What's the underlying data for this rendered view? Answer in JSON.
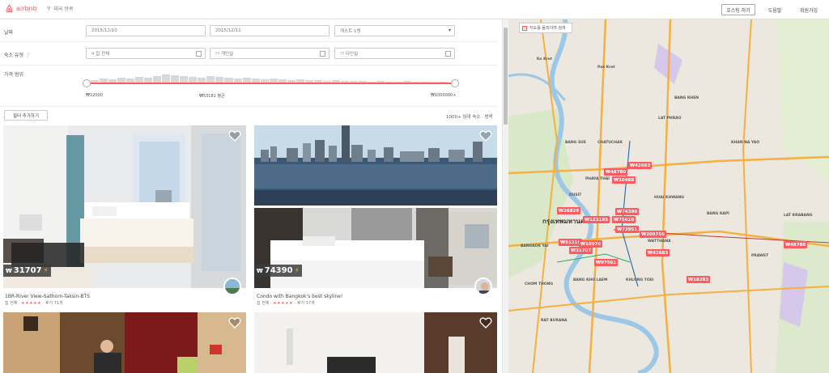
{
  "header": {
    "logo_text": "airbnb",
    "search_text": "태국 방콕",
    "host_label": "호스팅 하기",
    "help_label": "도움말",
    "signup_label": "회원가입"
  },
  "filters": {
    "dates_label": "날짜",
    "checkin": "2015/12/10",
    "checkout": "2015/12/11",
    "guests": "게스트 1명",
    "room_type_label": "숙소 유형",
    "room_types": [
      "집 전체",
      "개인실",
      "다인실"
    ],
    "price_label": "가격 범위",
    "price_min": "₩12000",
    "price_avg": "₩53181 평균",
    "price_max": "₩1000000+",
    "more_filters": "필터 추가하기",
    "result_count": "1000+ 임대 숙소 · 방콕"
  },
  "listings": [
    {
      "price": "31707",
      "title": "1BR-River View-Sathorn-Taksin-BTS",
      "type": "집 전체",
      "stars": "★★★★★",
      "reviews": "· 후기 71개"
    },
    {
      "price": "74390",
      "title": "Condo with Bangkok's best skyline!",
      "type": "집 전체",
      "stars": "★★★★★",
      "reviews": "· 후기 37개"
    }
  ],
  "map": {
    "search_checkbox_label": "지도를 움직이며 검색",
    "pins": [
      "₩48780",
      "₩42683",
      "₩10488",
      "₩74390",
      "₩26829",
      "₩123195",
      "₩75610",
      "₩73951",
      "₩209756",
      "₩51219",
      "₩10976",
      "₩31707",
      "₩42683",
      "₩97561",
      "₩18293",
      "₩48780"
    ],
    "labels": [
      "Pak Kret",
      "Ko Kret",
      "LAT PHRAO",
      "BANG KHEN",
      "KHAN NA YAO",
      "กรุงเทพมหานคร",
      "HUAI KHWANG",
      "BANG KAPI",
      "WATTHANA",
      "PRAWET",
      "CHOM THONG",
      "RAT BURANA",
      "BANG SUE",
      "CHATUCHAK",
      "DUSIT",
      "PHAYA THAI",
      "BANGKOK YAI",
      "BANG KHO LAEM",
      "KHLONG TOEI",
      "LAT KRABANG"
    ]
  },
  "colors": {
    "brand": "#ff5a5f",
    "map_water": "#9cc7e6",
    "map_road_major": "#f5b041",
    "map_green": "#cfe6b8"
  }
}
